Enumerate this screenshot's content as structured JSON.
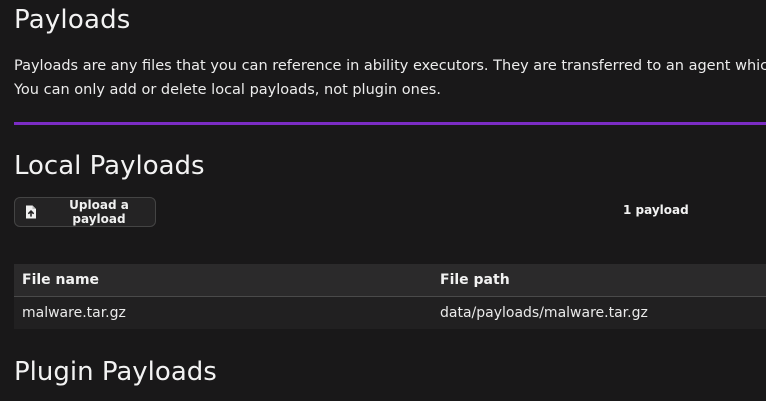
{
  "page": {
    "title": "Payloads",
    "description_line1": "Payloads are any files that you can reference in ability executors. They are transferred to an agent which car",
    "description_line2": "You can only add or delete local payloads, not plugin ones.",
    "accent_color": "#7b2cc4"
  },
  "local": {
    "heading": "Local Payloads",
    "upload_button_label": "Upload a payload",
    "upload_icon": "file-upload-icon",
    "count_text": "1 payload",
    "table": {
      "headers": [
        "File name",
        "File path"
      ],
      "rows": [
        {
          "name": "malware.tar.gz",
          "path": "data/payloads/malware.tar.gz"
        }
      ]
    }
  },
  "plugin": {
    "heading": "Plugin Payloads"
  }
}
